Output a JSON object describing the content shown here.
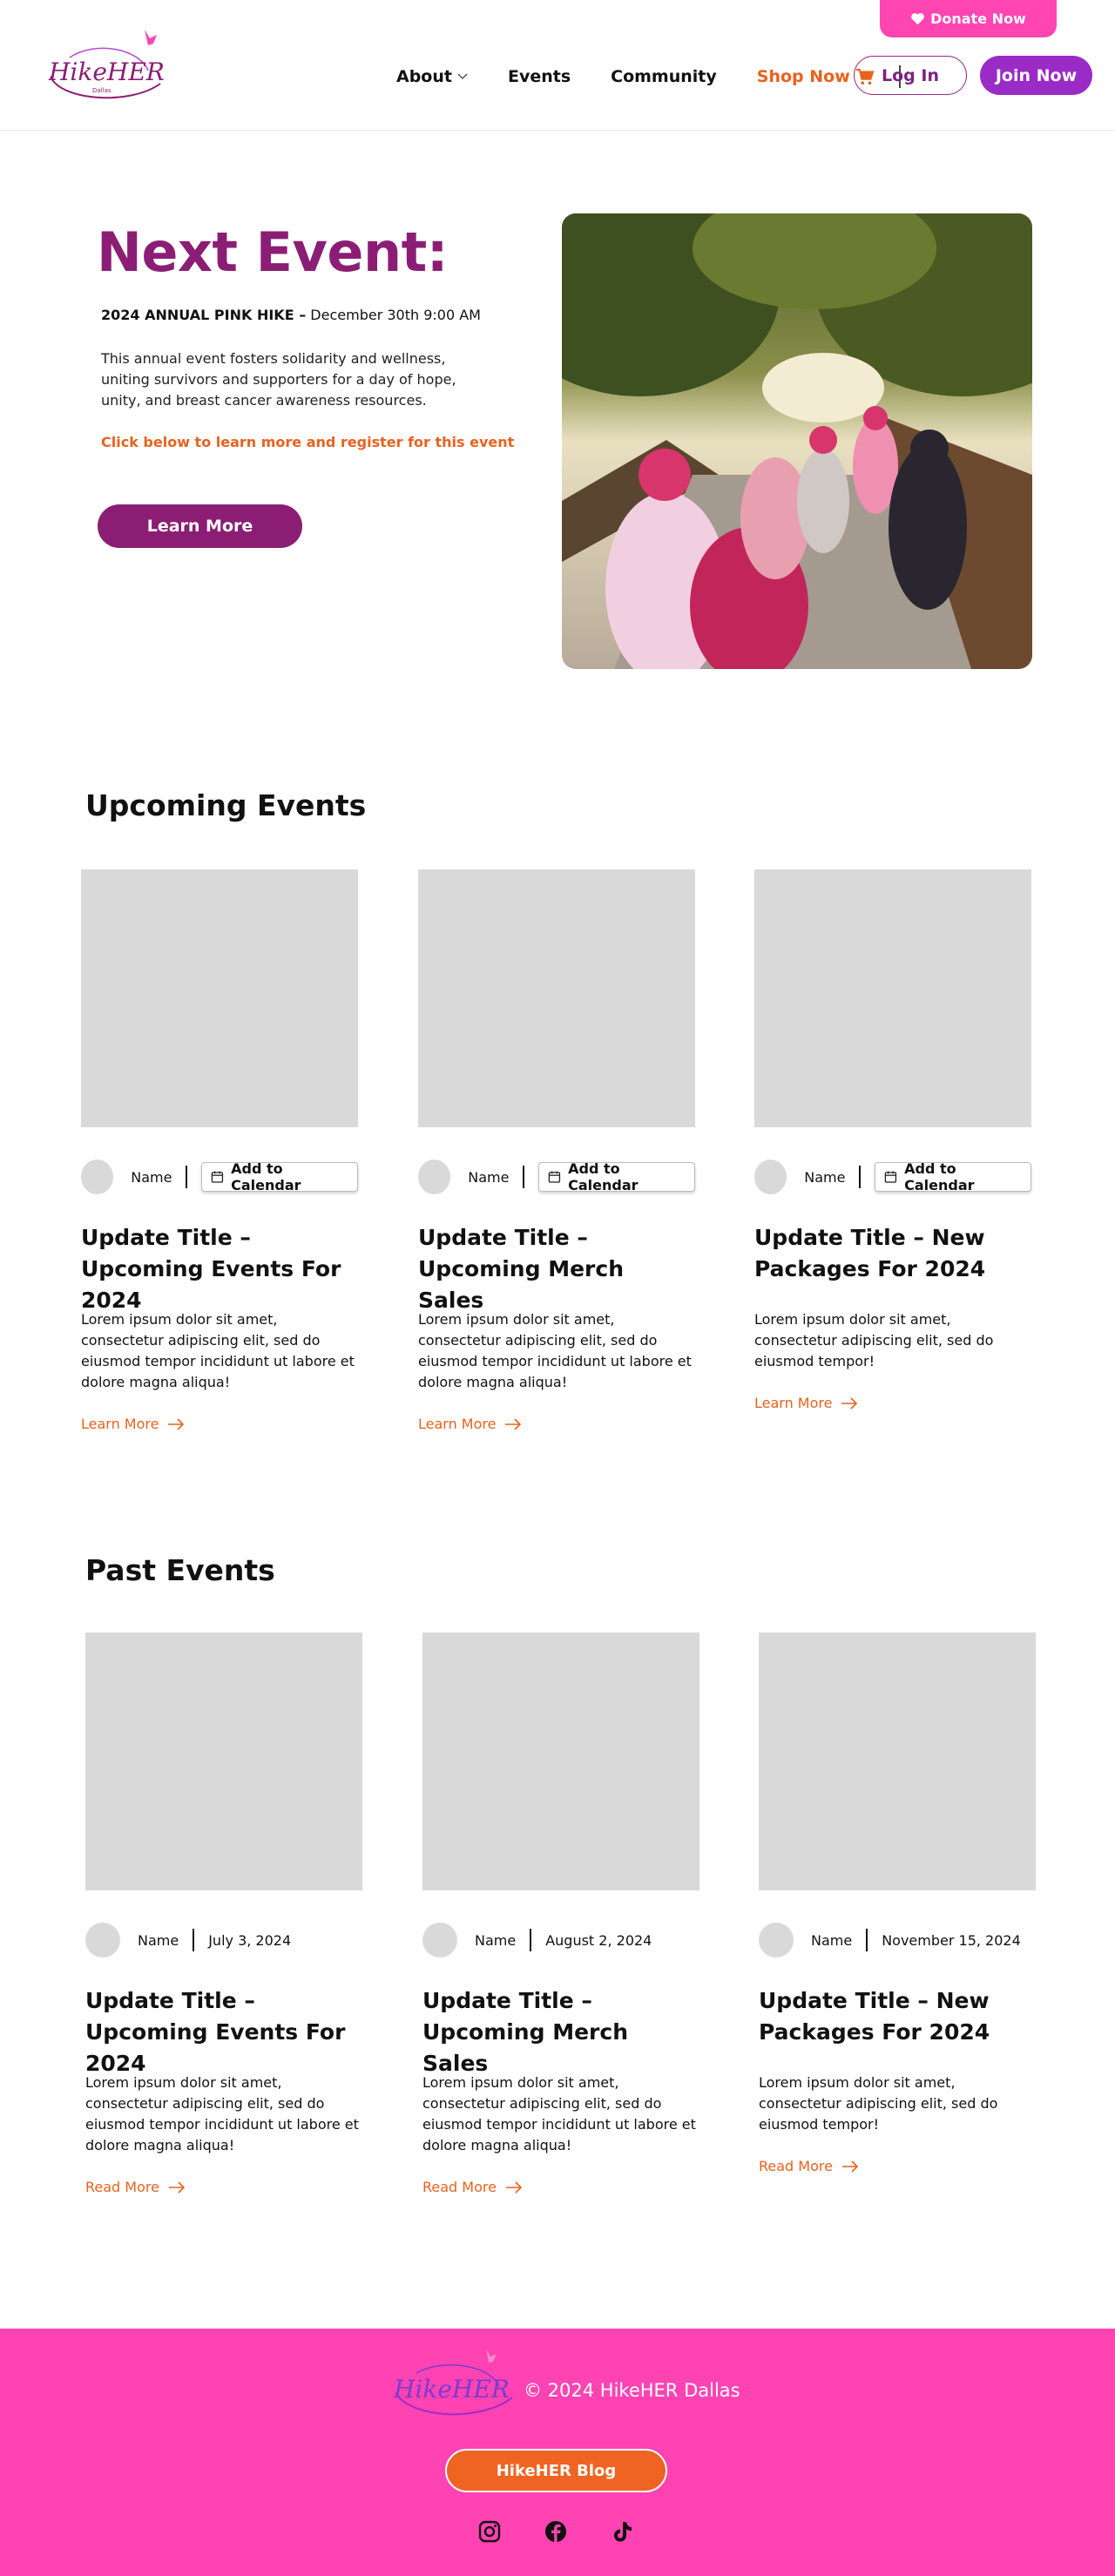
{
  "header": {
    "logo_text": "HikeHER",
    "logo_subtext": "Dallas",
    "donate_label": "Donate Now",
    "nav": {
      "about": "About",
      "events": "Events",
      "community": "Community",
      "shop": "Shop Now"
    },
    "login_label": "Log In",
    "join_label": "Join Now"
  },
  "hero": {
    "title": "Next Event:",
    "event_name": "2024 ANNUAL PINK HIKE –",
    "event_date": "December 30th 9:00 AM",
    "description": "This annual event fosters solidarity and wellness, uniting survivors and supporters for a day of hope, unity, and breast cancer awareness resources.",
    "cta_text": "Click below to learn more and register for this event",
    "button_label": "Learn More"
  },
  "upcoming": {
    "title": "Upcoming Events",
    "cards": [
      {
        "name": "Name",
        "calendar_label": "Add to Calendar",
        "title": "Update Title – Upcoming Events For 2024",
        "body": "Lorem ipsum dolor sit amet, consectetur adipiscing elit, sed do eiusmod tempor incididunt ut labore et dolore magna aliqua!",
        "link": "Learn More"
      },
      {
        "name": "Name",
        "calendar_label": "Add to Calendar",
        "title": "Update Title – Upcoming Merch Sales",
        "body": "Lorem ipsum dolor sit amet, consectetur adipiscing elit, sed do eiusmod tempor incididunt ut labore et dolore magna aliqua!",
        "link": "Learn More"
      },
      {
        "name": "Name",
        "calendar_label": "Add to Calendar",
        "title": "Update Title – New Packages For 2024",
        "body": "Lorem ipsum dolor sit amet, consectetur adipiscing elit, sed do eiusmod tempor!",
        "link": "Learn More"
      }
    ]
  },
  "past": {
    "title": "Past Events",
    "cards": [
      {
        "name": "Name",
        "date": "July 3, 2024",
        "title": "Update Title – Upcoming Events For 2024",
        "body": "Lorem ipsum dolor sit amet, consectetur adipiscing elit, sed do eiusmod tempor incididunt ut labore et dolore magna aliqua!",
        "link": "Read More"
      },
      {
        "name": "Name",
        "date": "August 2, 2024",
        "title": "Update Title – Upcoming Merch Sales",
        "body": "Lorem ipsum dolor sit amet, consectetur adipiscing elit, sed do eiusmod tempor incididunt ut labore et dolore magna aliqua!",
        "link": "Read More"
      },
      {
        "name": "Name",
        "date": "November 15, 2024",
        "title": "Update Title – New Packages For 2024",
        "body": "Lorem ipsum dolor sit amet, consectetur adipiscing elit, sed do eiusmod tempor!",
        "link": "Read More"
      }
    ]
  },
  "footer": {
    "copyright": "© 2024 HikeHER Dallas",
    "blog_label": "HikeHER Blog",
    "social": [
      "instagram-icon",
      "facebook-icon",
      "tiktok-icon"
    ]
  },
  "colors": {
    "brand_purple": "#8b1e74",
    "join_purple": "#9b2bc7",
    "pink": "#ff45b2",
    "orange": "#e8621f"
  }
}
